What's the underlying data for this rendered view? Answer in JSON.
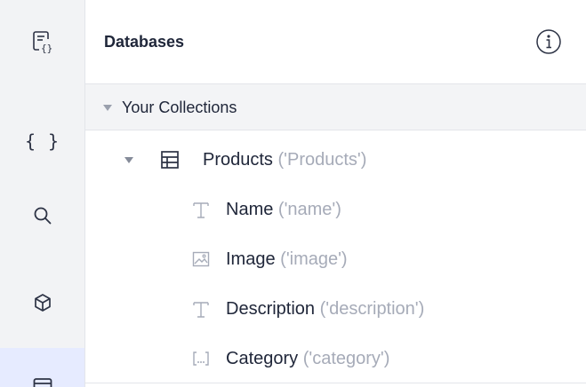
{
  "rail": {
    "items": [
      {
        "name": "data-page-icon"
      },
      {
        "name": "code-braces-icon",
        "glyph": "{ }"
      },
      {
        "name": "search-icon"
      },
      {
        "name": "package-icon"
      },
      {
        "name": "database-icon",
        "active": true
      }
    ]
  },
  "panel": {
    "title": "Databases",
    "info_icon": "info-icon"
  },
  "section": {
    "label": "Your Collections"
  },
  "collection": {
    "name": "Products",
    "key": "('Products')",
    "icon": "table-icon"
  },
  "fields": [
    {
      "name": "Name",
      "key": "('name')",
      "icon": "text-type-icon"
    },
    {
      "name": "Image",
      "key": "('image')",
      "icon": "image-type-icon"
    },
    {
      "name": "Description",
      "key": "('description')",
      "icon": "text-type-icon"
    },
    {
      "name": "Category",
      "key": "('category')",
      "icon": "tags-type-icon"
    }
  ],
  "colors": {
    "rail_bg": "#f2f3f5",
    "active_bg": "#e6ebff",
    "muted_text": "#a6abb8",
    "text": "#20273a"
  }
}
